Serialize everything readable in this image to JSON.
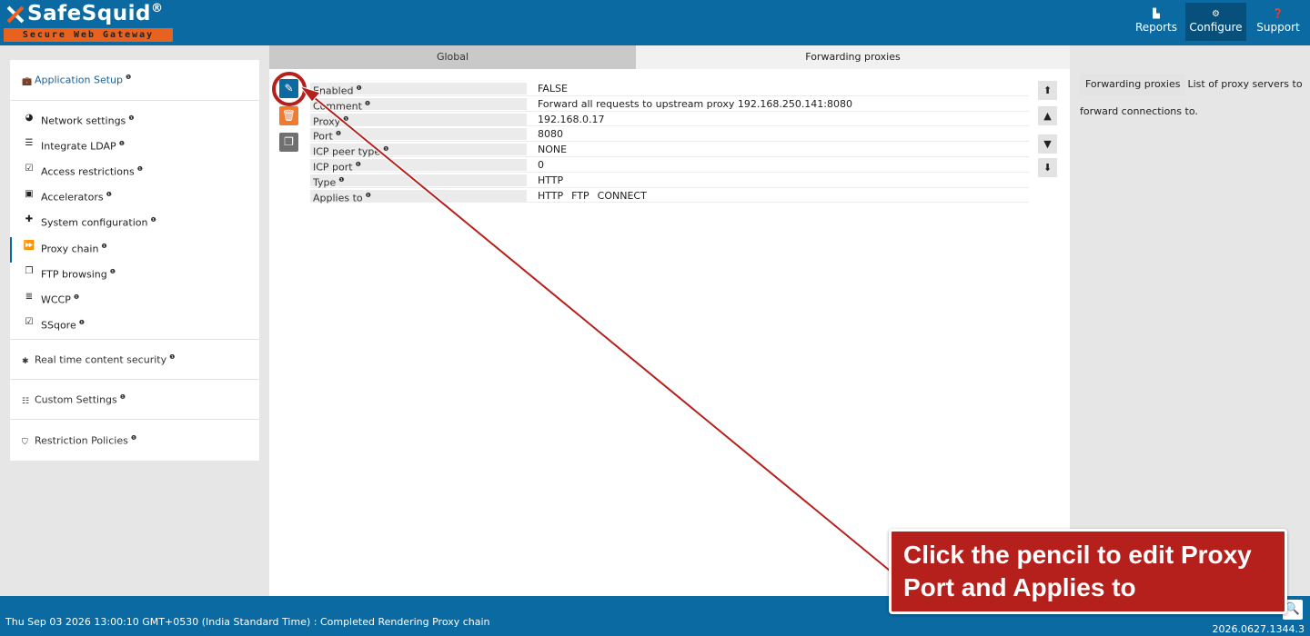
{
  "brand": {
    "name": "SafeSquid",
    "reg": "®",
    "tagline": "Secure Web Gateway"
  },
  "nav": [
    {
      "label": "Reports",
      "icon": "chart-icon",
      "active": false
    },
    {
      "label": "Configure",
      "icon": "gears-icon",
      "active": true
    },
    {
      "label": "Support",
      "icon": "help-icon",
      "active": false
    }
  ],
  "tabs": {
    "global": "Global",
    "forwarding": "Forwarding proxies"
  },
  "sidebar": {
    "application_setup": "Application Setup",
    "items": [
      {
        "label": "Network settings",
        "icon": "globe-icon"
      },
      {
        "label": "Integrate LDAP",
        "icon": "list-icon"
      },
      {
        "label": "Access restrictions",
        "icon": "checkbox-icon"
      },
      {
        "label": "Accelerators",
        "icon": "train-icon"
      },
      {
        "label": "System configuration",
        "icon": "puzzle-icon"
      },
      {
        "label": "Proxy chain",
        "icon": "fast-forward-icon"
      },
      {
        "label": "FTP browsing",
        "icon": "copy-icon"
      },
      {
        "label": "WCCP",
        "icon": "server-icon"
      },
      {
        "label": "SSqore",
        "icon": "checkbox-icon"
      }
    ],
    "real_time": "Real time content security",
    "custom": "Custom Settings",
    "restriction": "Restriction Policies"
  },
  "properties": [
    {
      "key": "Enabled",
      "value": "FALSE"
    },
    {
      "key": "Comment",
      "value": "Forward all requests to upstream proxy 192.168.250.141:8080"
    },
    {
      "key": "Proxy",
      "value": "192.168.0.17"
    },
    {
      "key": "Port",
      "value": "8080"
    },
    {
      "key": "ICP peer type",
      "value": "NONE"
    },
    {
      "key": "ICP port",
      "value": "0"
    },
    {
      "key": "Type",
      "value": "HTTP"
    },
    {
      "key": "Applies to",
      "values": [
        "HTTP",
        "FTP",
        "CONNECT"
      ]
    }
  ],
  "help": {
    "tag": "Forwarding proxies",
    "text": "List of proxy servers to forward connections to."
  },
  "footer": {
    "status": "Thu Sep 03 2026 13:00:10 GMT+0530 (India Standard Time) : Completed Rendering Proxy chain",
    "version": "2026.0627.1344.3"
  },
  "annotation": {
    "text": "Click the pencil to edit Proxy Port and Applies to",
    "color": "#b6201c"
  },
  "colors": {
    "primary": "#0a6aa1",
    "accent": "#e8621f",
    "active_nav": "#08507c"
  }
}
